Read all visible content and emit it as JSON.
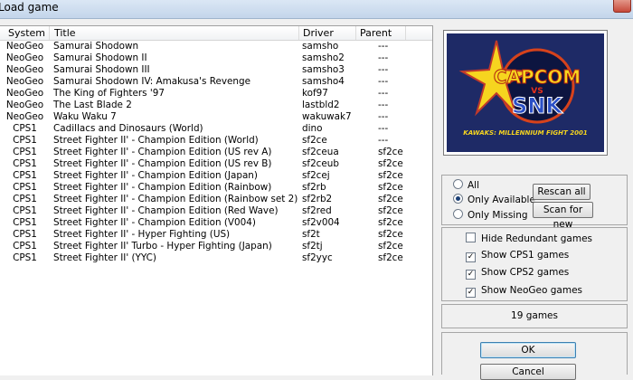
{
  "window": {
    "title": "Load game"
  },
  "columns": {
    "system": "System",
    "title": "Title",
    "driver": "Driver",
    "parent": "Parent"
  },
  "games": [
    {
      "system": "NeoGeo",
      "title": "Samurai Shodown",
      "driver": "samsho",
      "parent": "---"
    },
    {
      "system": "NeoGeo",
      "title": "Samurai Shodown II",
      "driver": "samsho2",
      "parent": "---"
    },
    {
      "system": "NeoGeo",
      "title": "Samurai Shodown III",
      "driver": "samsho3",
      "parent": "---"
    },
    {
      "system": "NeoGeo",
      "title": "Samurai Shodown IV: Amakusa's Revenge",
      "driver": "samsho4",
      "parent": "---"
    },
    {
      "system": "NeoGeo",
      "title": "The King of Fighters '97",
      "driver": "kof97",
      "parent": "---"
    },
    {
      "system": "NeoGeo",
      "title": "The Last Blade 2",
      "driver": "lastbld2",
      "parent": "---"
    },
    {
      "system": "NeoGeo",
      "title": "Waku Waku 7",
      "driver": "wakuwak7",
      "parent": "---"
    },
    {
      "system": "CPS1",
      "title": "Cadillacs and Dinosaurs (World)",
      "driver": "dino",
      "parent": "---"
    },
    {
      "system": "CPS1",
      "title": "Street Fighter II' - Champion Edition (World)",
      "driver": "sf2ce",
      "parent": "---"
    },
    {
      "system": "CPS1",
      "title": "Street Fighter II' - Champion Edition (US rev A)",
      "driver": "sf2ceua",
      "parent": "sf2ce"
    },
    {
      "system": "CPS1",
      "title": "Street Fighter II' - Champion Edition (US rev B)",
      "driver": "sf2ceub",
      "parent": "sf2ce"
    },
    {
      "system": "CPS1",
      "title": "Street Fighter II' - Champion Edition (Japan)",
      "driver": "sf2cej",
      "parent": "sf2ce"
    },
    {
      "system": "CPS1",
      "title": "Street Fighter II' - Champion Edition (Rainbow)",
      "driver": "sf2rb",
      "parent": "sf2ce"
    },
    {
      "system": "CPS1",
      "title": "Street Fighter II' - Champion Edition (Rainbow set 2)",
      "driver": "sf2rb2",
      "parent": "sf2ce"
    },
    {
      "system": "CPS1",
      "title": "Street Fighter II' - Champion Edition (Red Wave)",
      "driver": "sf2red",
      "parent": "sf2ce"
    },
    {
      "system": "CPS1",
      "title": "Street Fighter II' - Champion Edition (V004)",
      "driver": "sf2v004",
      "parent": "sf2ce"
    },
    {
      "system": "CPS1",
      "title": "Street Fighter II' - Hyper Fighting (US)",
      "driver": "sf2t",
      "parent": "sf2ce"
    },
    {
      "system": "CPS1",
      "title": "Street Fighter II' Turbo - Hyper Fighting (Japan)",
      "driver": "sf2tj",
      "parent": "sf2ce"
    },
    {
      "system": "CPS1",
      "title": "Street Fighter II' (YYC)",
      "driver": "sf2yyc",
      "parent": "sf2ce"
    }
  ],
  "preview": {
    "logo_top": "CAPCOM",
    "logo_vs": "VS",
    "logo_bottom": "SNK",
    "subtitle": "KAWAKS: MILLENNIUM FIGHT 2001"
  },
  "filter": {
    "all": "All",
    "only_available": "Only Available",
    "only_missing": "Only Missing",
    "selected": "only_available",
    "rescan_all": "Rescan all",
    "scan_for_new": "Scan for new"
  },
  "options": {
    "hide_redundant": {
      "label": "Hide Redundant games",
      "checked": false
    },
    "show_cps1": {
      "label": "Show CPS1 games",
      "checked": true
    },
    "show_cps2": {
      "label": "Show CPS2 games",
      "checked": true
    },
    "show_neogeo": {
      "label": "Show NeoGeo games",
      "checked": true
    }
  },
  "status": {
    "game_count": "19 games"
  },
  "buttons": {
    "ok": "OK",
    "cancel": "Cancel"
  },
  "colors": {
    "logo_bg": "#1e2a66",
    "capcom_yellow": "#f6d51f",
    "snk_blue": "#2a4fc6"
  }
}
